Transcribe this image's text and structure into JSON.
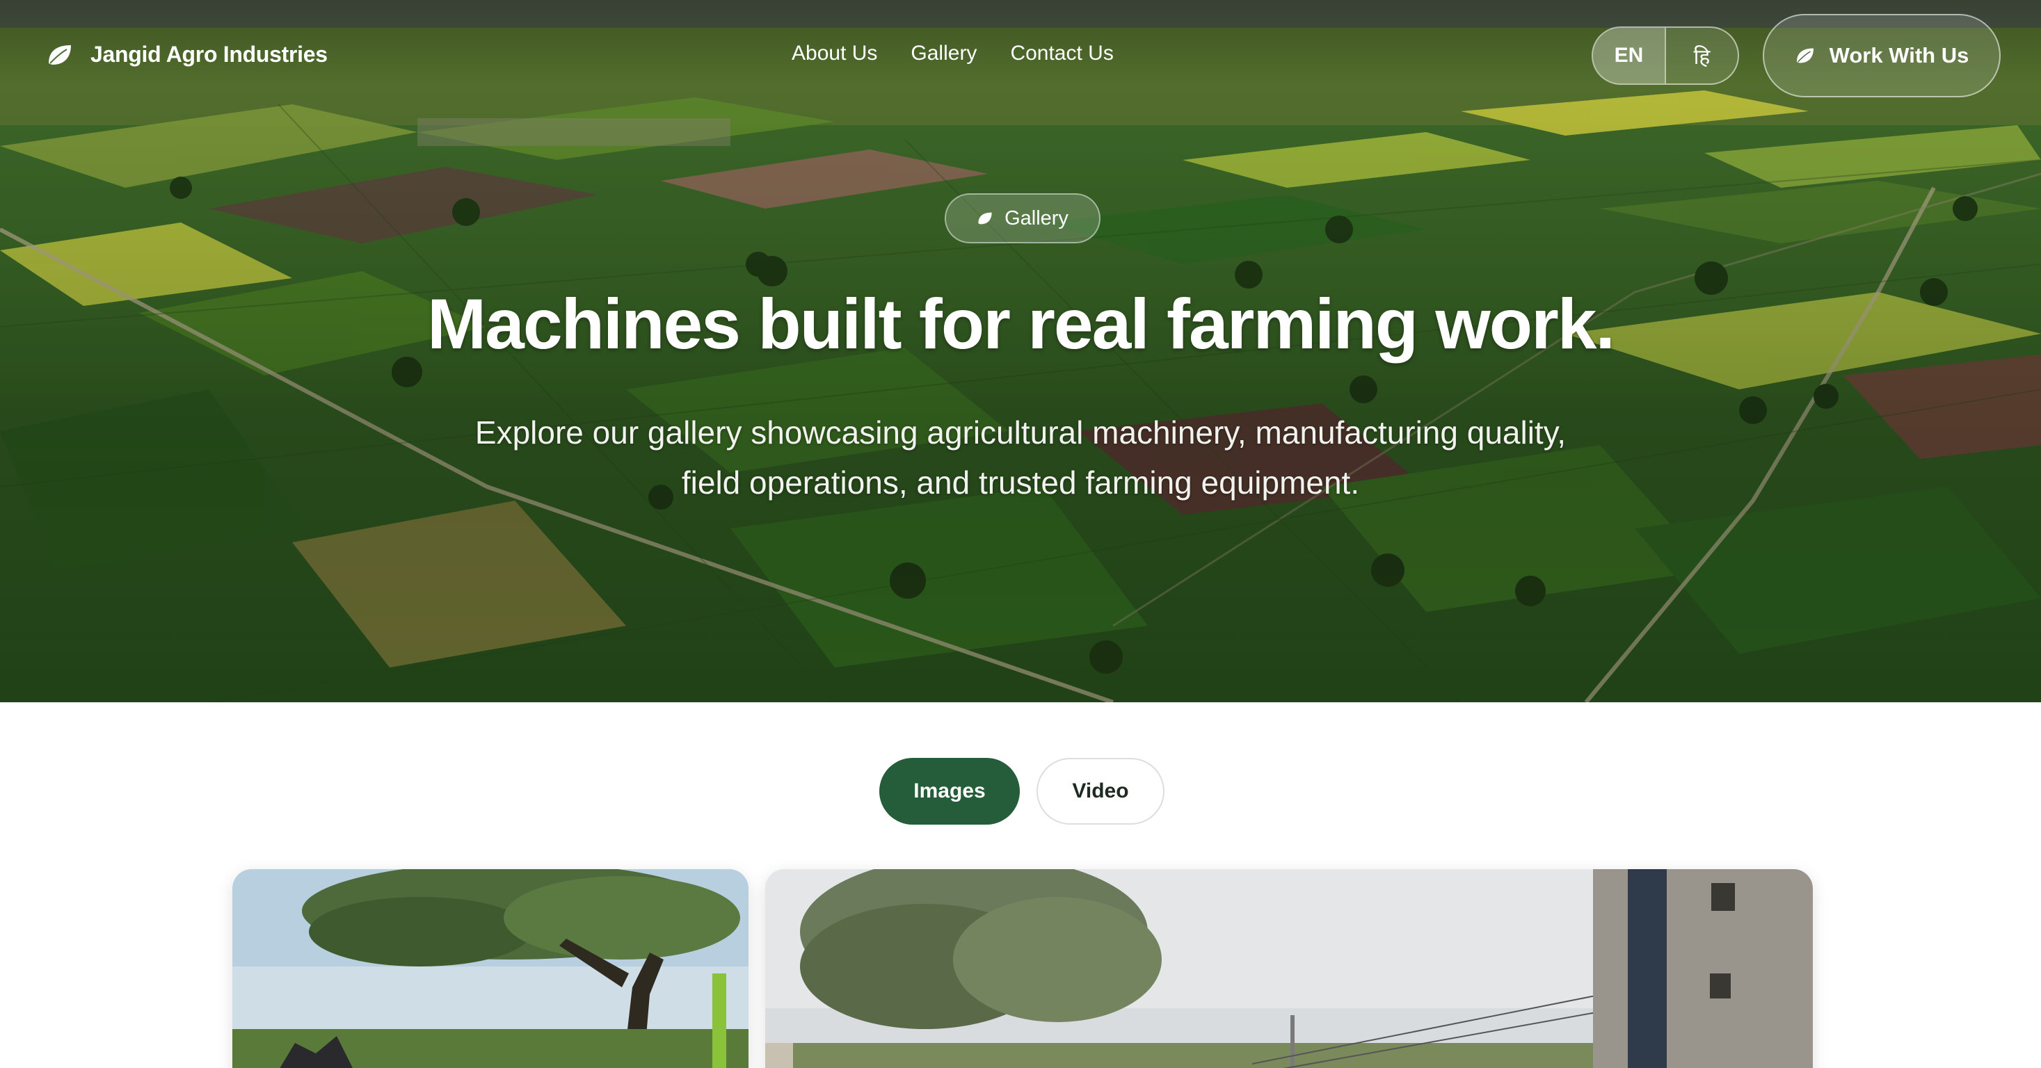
{
  "nav": {
    "brand_name": "Jangid Agro Industries",
    "links": [
      {
        "label": "About Us"
      },
      {
        "label": "Gallery"
      },
      {
        "label": "Contact Us"
      }
    ],
    "language": {
      "en": "EN",
      "hi": "हि",
      "active": "EN"
    },
    "cta_label": "Work With Us"
  },
  "hero": {
    "badge": "Gallery",
    "title": "Machines built for real farming work.",
    "subtitle_line1": "Explore our gallery showcasing agricultural machinery, manufacturing quality,",
    "subtitle_line2": "field operations, and trusted farming equipment."
  },
  "tabs": [
    {
      "label": "Images",
      "active": true
    },
    {
      "label": "Video",
      "active": false
    }
  ],
  "colors": {
    "accent": "#255c39",
    "text_on_hero": "#ffffff",
    "page_bg": "#ffffff"
  },
  "icons": {
    "brand": "leaf-icon",
    "cta": "leaf-icon",
    "badge": "leaf-icon"
  }
}
